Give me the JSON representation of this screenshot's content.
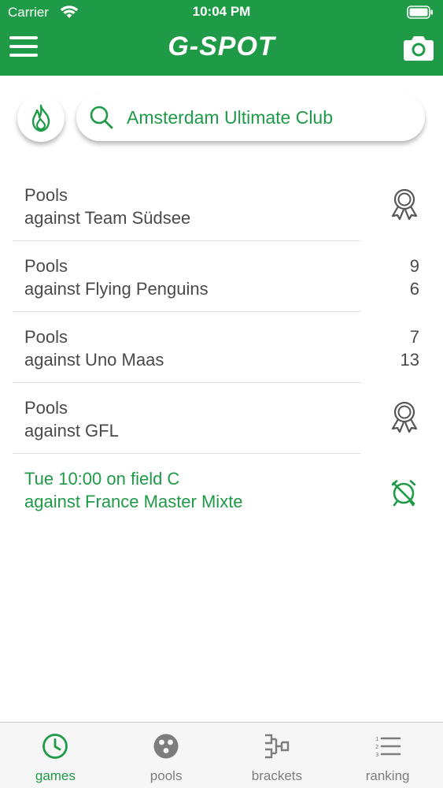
{
  "status_bar": {
    "carrier": "Carrier",
    "time": "10:04 PM"
  },
  "header": {
    "logo": "G-SPOT",
    "menu_icon": "hamburger-menu-icon",
    "camera_icon": "camera-icon"
  },
  "search": {
    "value": "Amsterdam Ultimate Club",
    "hot_icon": "flame-icon",
    "search_icon": "search-icon"
  },
  "games": [
    {
      "line1": "Pools",
      "line2": "against Team Südsee",
      "result_icon": "award-ribbon-icon"
    },
    {
      "line1": "Pools",
      "line2": "against Flying Penguins",
      "score_own": "9",
      "score_opponent": "6"
    },
    {
      "line1": "Pools",
      "line2": "against Uno Maas",
      "score_own": "7",
      "score_opponent": "13"
    },
    {
      "line1": "Pools",
      "line2": "against GFL",
      "result_icon": "award-ribbon-icon"
    },
    {
      "line1": "Tue 10:00 on field C",
      "line2": "against France Master Mixte",
      "result_icon": "alarm-clock-off-icon",
      "upcoming": true
    }
  ],
  "tabs": [
    {
      "label": "games",
      "icon": "clock-icon",
      "active": true
    },
    {
      "label": "pools",
      "icon": "pool-dots-icon"
    },
    {
      "label": "brackets",
      "icon": "bracket-icon"
    },
    {
      "label": "ranking",
      "icon": "ranked-list-icon"
    }
  ],
  "colors": {
    "brand_green": "#1f9a47",
    "text_gray": "#4a4a4a",
    "tab_inactive": "#7d7d7d"
  }
}
